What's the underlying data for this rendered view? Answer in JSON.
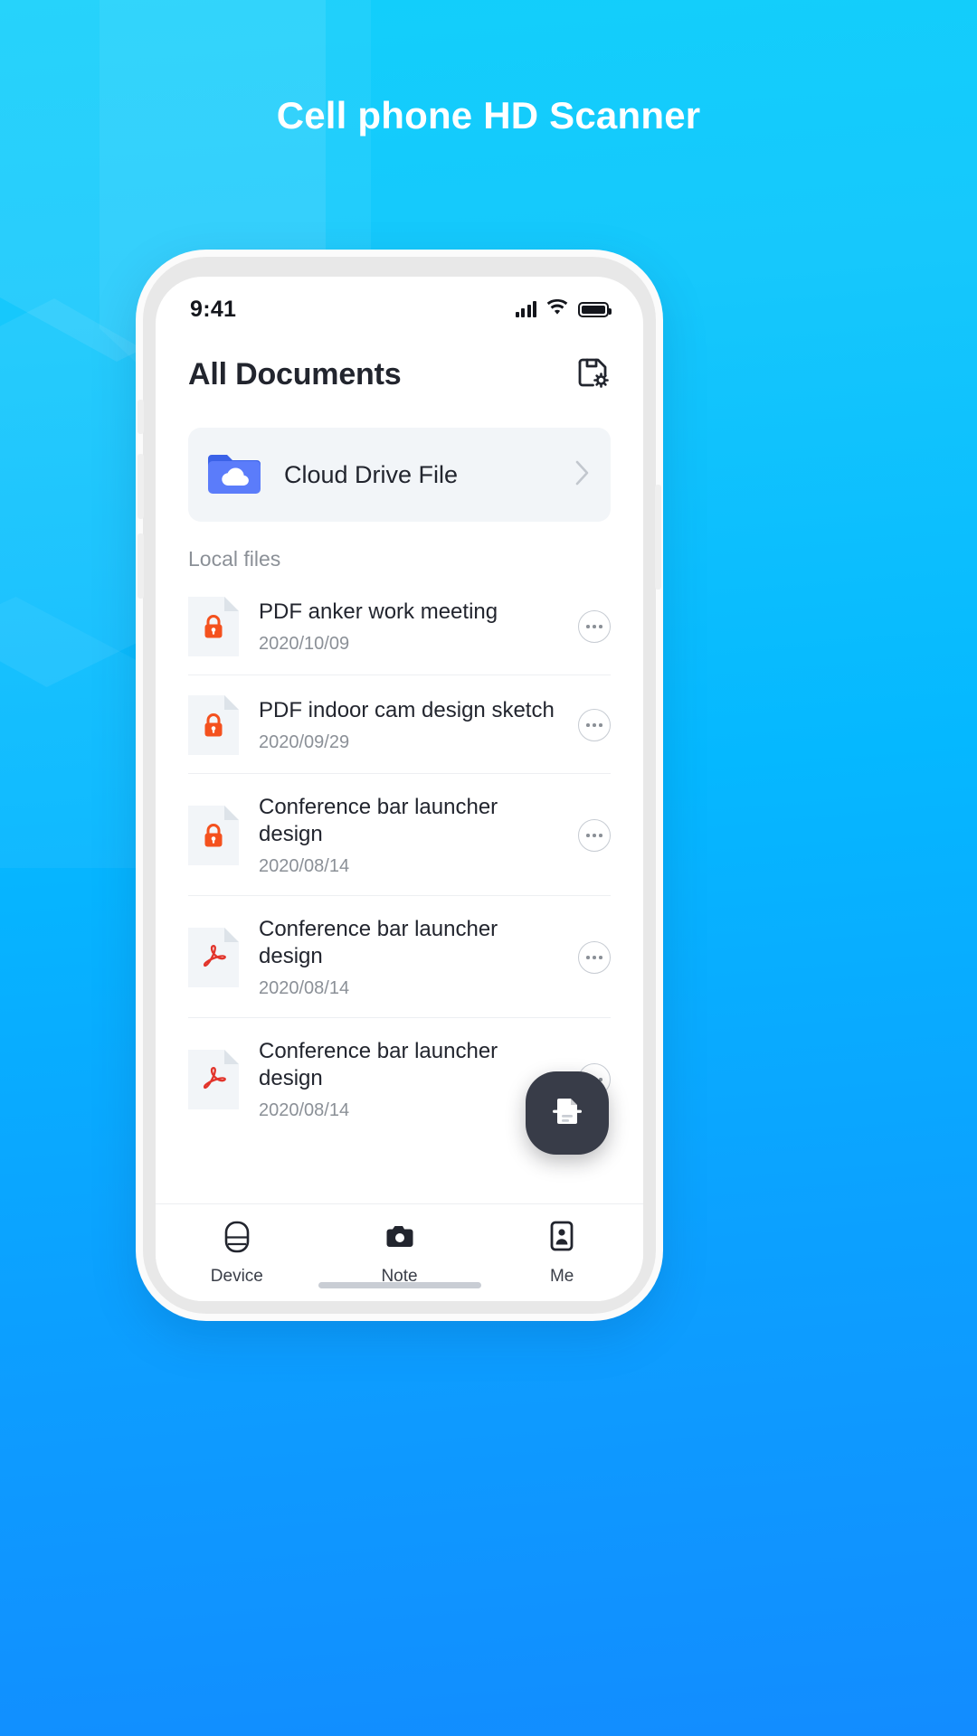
{
  "hero": {
    "title": "Cell phone HD Scanner"
  },
  "colors": {
    "bg_gradient_start": "#12CFFB",
    "bg_gradient_end": "#128CFF",
    "accent_blue": "#5B7CFA",
    "lock_orange": "#F4511E",
    "pdf_red": "#E2342B",
    "text_dark": "#22252E",
    "text_muted": "#8B9097",
    "fab_dark": "#383C48",
    "card_grey": "#F2F5F8"
  },
  "status_bar": {
    "time": "9:41",
    "icons": [
      "cellular-signal-icon",
      "wifi-icon",
      "battery-icon"
    ]
  },
  "header": {
    "title": "All Documents",
    "action_icon": "save-settings-icon"
  },
  "cloud_card": {
    "icon": "cloud-folder-icon",
    "label": "Cloud Drive File",
    "chevron": "chevron-right-icon"
  },
  "section": {
    "label": "Local files"
  },
  "files": [
    {
      "name": "PDF anker work meeting",
      "date": "2020/10/09",
      "icon": "locked-document-icon"
    },
    {
      "name": "PDF indoor cam design sketch",
      "date": "2020/09/29",
      "icon": "locked-document-icon"
    },
    {
      "name": "Conference bar launcher design",
      "date": "2020/08/14",
      "icon": "locked-document-icon"
    },
    {
      "name": "Conference bar launcher design",
      "date": "2020/08/14",
      "icon": "pdf-document-icon"
    },
    {
      "name": "Conference bar launcher design",
      "date": "2020/08/14",
      "icon": "pdf-document-icon"
    }
  ],
  "fab": {
    "icon": "scan-document-icon"
  },
  "tabbar": {
    "items": [
      {
        "label": "Device",
        "icon": "device-icon",
        "active": false
      },
      {
        "label": "Note",
        "icon": "camera-icon",
        "active": true
      },
      {
        "label": "Me",
        "icon": "profile-icon",
        "active": false
      }
    ]
  }
}
